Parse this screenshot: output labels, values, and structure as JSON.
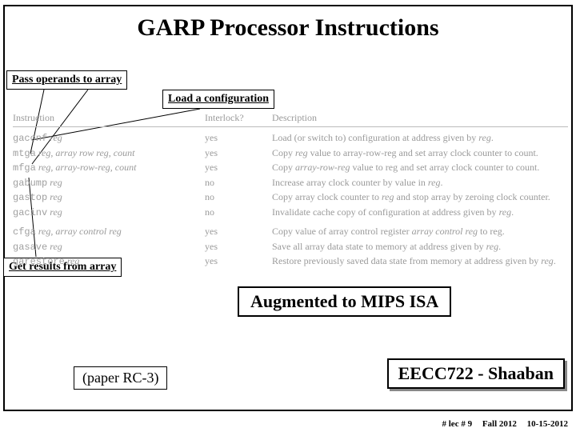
{
  "title": "GARP Processor Instructions",
  "callouts": {
    "pass": "Pass operands to array",
    "load": "Load a configuration",
    "get": "Get results from array"
  },
  "augmented": "Augmented to MIPS ISA",
  "paper": "(paper RC-3)",
  "eecc": "EECC722 - Shaaban",
  "footer": {
    "lec": "#  lec # 9",
    "term": "Fall 2012",
    "date": "10-15-2012"
  },
  "table": {
    "headers": {
      "instr": "Instruction",
      "lock": "Interlock?",
      "desc": "Description"
    },
    "rows": [
      {
        "mnem": "gaconf",
        "args": "reg",
        "lock": "yes",
        "desc_pre": "Load (or switch to) configuration at address given by ",
        "desc_it": "reg",
        "desc_post": "."
      },
      {
        "mnem": "mtga",
        "args": "reg, array row reg, count",
        "lock": "yes",
        "desc_pre": "Copy ",
        "desc_it": "reg",
        "desc_post": " value to array-row-reg and set array clock counter to count."
      },
      {
        "mnem": "mfga",
        "args": "reg, array-row-reg, count",
        "lock": "yes",
        "desc_pre": "Copy ",
        "desc_it": "array-row-reg",
        "desc_post": " value to reg and set array clock counter to count."
      },
      {
        "mnem": "gabump",
        "args": "reg",
        "lock": "no",
        "desc_pre": "Increase array clock counter by value in ",
        "desc_it": "reg",
        "desc_post": "."
      },
      {
        "mnem": "gastop",
        "args": "reg",
        "lock": "no",
        "desc_pre": "Copy array clock counter to ",
        "desc_it": "reg",
        "desc_post": " and stop array by zeroing clock counter."
      },
      {
        "mnem": "gacinv",
        "args": "reg",
        "lock": "no",
        "desc_pre": "Invalidate cache copy of configuration at address given by ",
        "desc_it": "reg",
        "desc_post": "."
      },
      {
        "spacer": true
      },
      {
        "mnem": "cfga",
        "args": "reg, array control reg",
        "lock": "yes",
        "desc_pre": "Copy value of array control register ",
        "desc_it": "array control reg",
        "desc_post": " to reg."
      },
      {
        "mnem": "gasave",
        "args": "reg",
        "lock": "yes",
        "desc_pre": "Save all array data state to memory at address given by ",
        "desc_it": "reg",
        "desc_post": "."
      },
      {
        "mnem": "garestore",
        "args": "reg",
        "lock": "yes",
        "desc_pre": "Restore previously saved data state from memory at address given by ",
        "desc_it": "reg",
        "desc_post": "."
      }
    ]
  }
}
